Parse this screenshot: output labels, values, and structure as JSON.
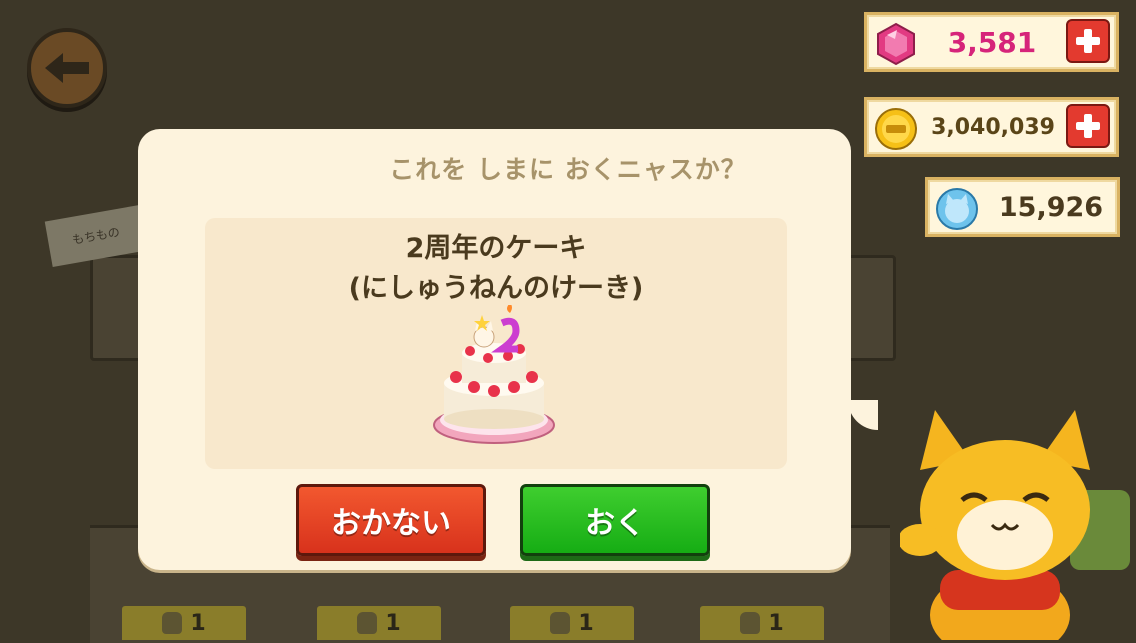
{
  "hud": {
    "gems": "3,581",
    "coins": "3,040,039",
    "tokens": "15,926"
  },
  "background": {
    "label": "もちもの",
    "slots": [
      "1",
      "1",
      "1",
      "1"
    ]
  },
  "dialog": {
    "title": "これを しまに おくニャスか？",
    "item_name": "2周年のケーキ",
    "item_reading": "(にしゅうねんのけーき)",
    "cancel_label": "おかない",
    "confirm_label": "おく"
  },
  "colors": {
    "gem_text": "#d6247a",
    "coin_text": "#5a4518",
    "token_text": "#4a3a1e",
    "cancel_button": "#e0401f",
    "confirm_button": "#22b81b"
  }
}
